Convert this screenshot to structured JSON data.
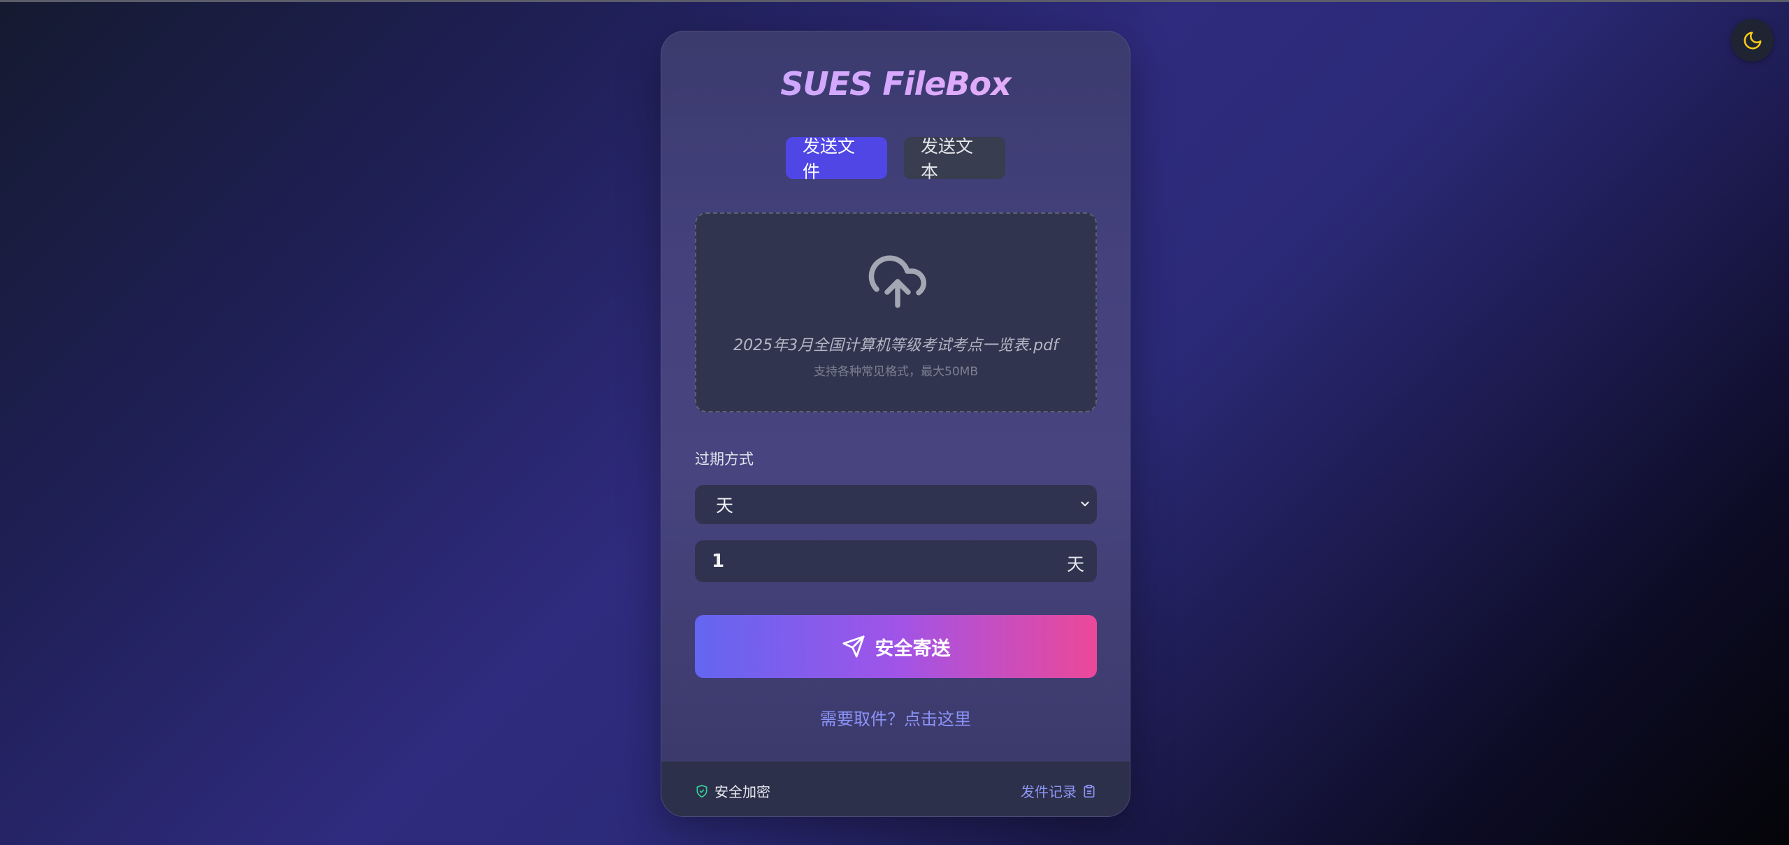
{
  "app": {
    "title": "SUES FileBox"
  },
  "tabs": [
    {
      "label": "发送文件",
      "active": true
    },
    {
      "label": "发送文本",
      "active": false
    }
  ],
  "dropzone": {
    "file_name": "2025年3月全国计算机等级考试考点一览表.pdf",
    "hint": "支持各种常见格式，最大50MB",
    "icon": "cloud-upload-icon"
  },
  "expiry": {
    "label": "过期方式",
    "selected": "天",
    "value": "1",
    "unit": "天"
  },
  "submit": {
    "label": "安全寄送",
    "icon": "send-icon"
  },
  "pickup_link": "需要取件？点击这里",
  "footer": {
    "secure_label": "安全加密",
    "history_label": "发件记录"
  },
  "colors": {
    "accent": "#4f46e5",
    "gradient_start": "#6366f1",
    "gradient_end": "#ec4899",
    "link": "#8b93f8",
    "secure_icon": "#34d399",
    "moon_icon": "#facc15"
  },
  "theme_toggle": {
    "icon": "moon-icon"
  }
}
